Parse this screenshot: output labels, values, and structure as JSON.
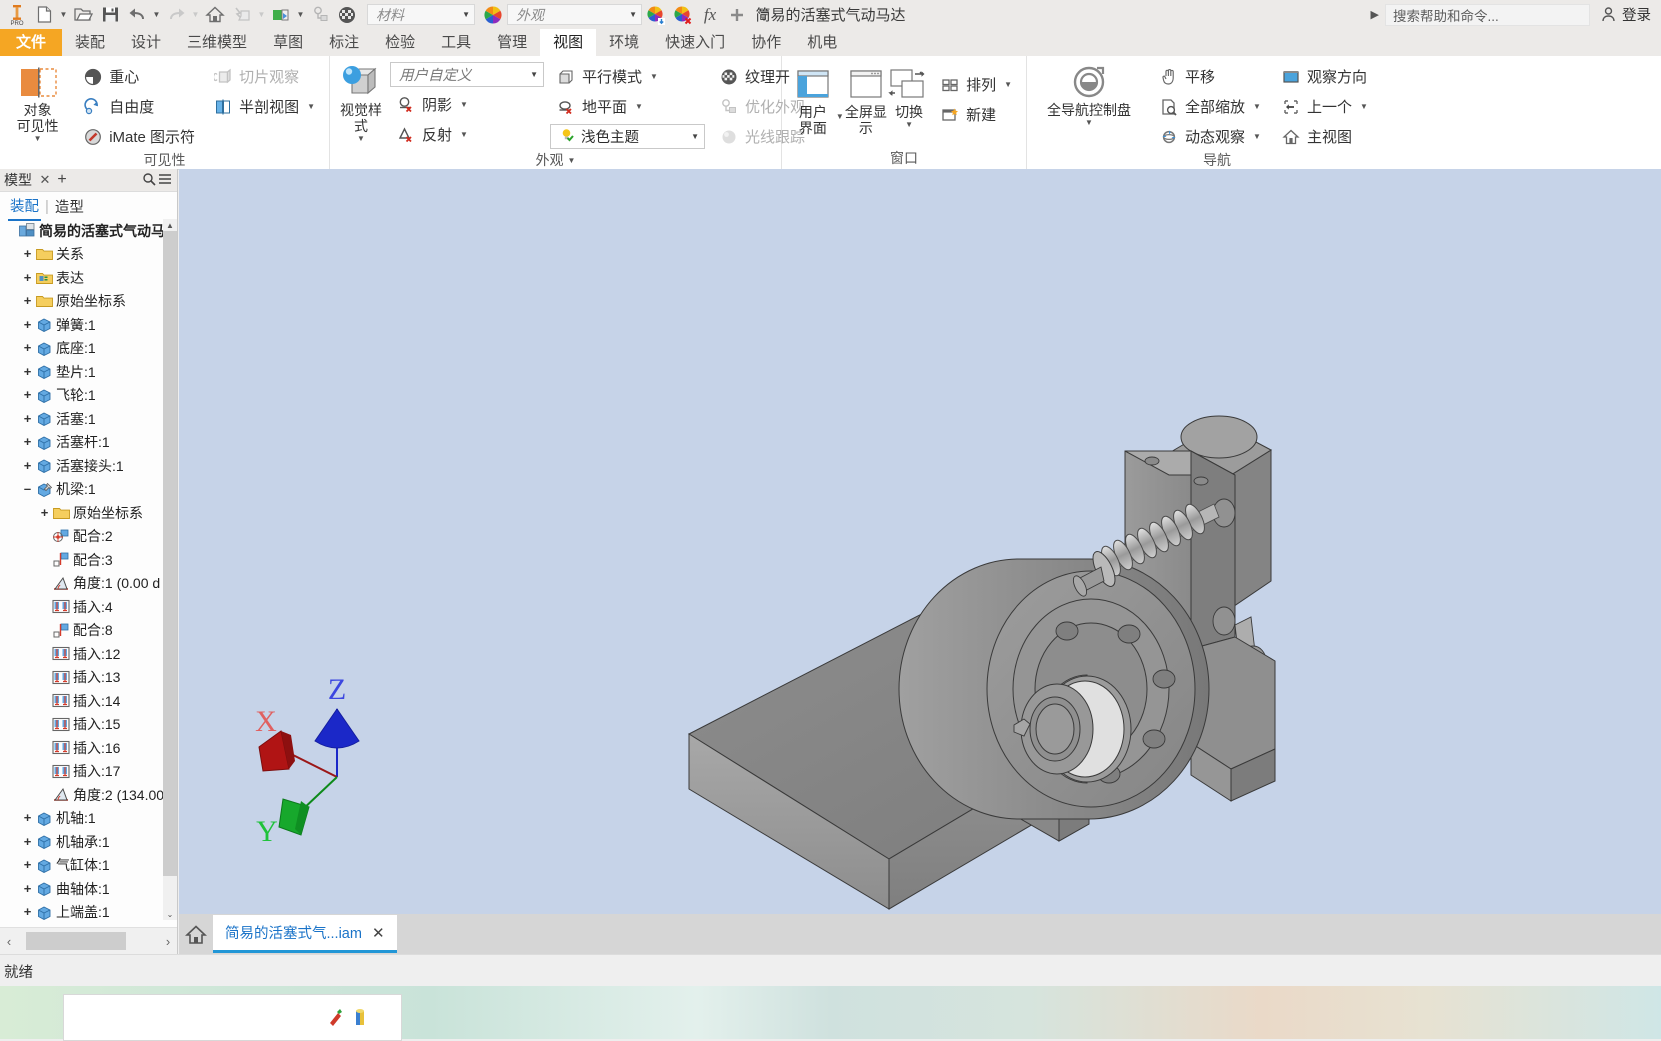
{
  "app": {
    "title": "简易的活塞式气动马达",
    "status": "就绪"
  },
  "quick_access": {
    "icons": [
      {
        "name": "inventor-logo-icon",
        "glyph": "PRO"
      },
      {
        "name": "new-file-icon",
        "glyph": "new"
      },
      {
        "name": "open-file-icon",
        "glyph": "open"
      },
      {
        "name": "save-icon",
        "glyph": "save"
      },
      {
        "name": "undo-icon",
        "glyph": "undo"
      },
      {
        "name": "redo-icon",
        "glyph": "redo"
      },
      {
        "name": "home-icon",
        "glyph": "home"
      },
      {
        "name": "update-icon",
        "glyph": "update"
      },
      {
        "name": "material-swatch-icon",
        "glyph": "swatch"
      },
      {
        "name": "select-icon",
        "glyph": "select"
      },
      {
        "name": "texture-icon",
        "glyph": "texture"
      }
    ],
    "material_placeholder": "材料",
    "appearance_placeholder": "外观",
    "fx_label": "fx"
  },
  "search": {
    "placeholder": "搜索帮助和命令...",
    "signin_label": "登录"
  },
  "tabs": [
    {
      "label": "文件",
      "kind": "file"
    },
    {
      "label": "装配",
      "kind": "normal"
    },
    {
      "label": "设计",
      "kind": "normal"
    },
    {
      "label": "三维模型",
      "kind": "normal"
    },
    {
      "label": "草图",
      "kind": "normal"
    },
    {
      "label": "标注",
      "kind": "normal"
    },
    {
      "label": "检验",
      "kind": "normal"
    },
    {
      "label": "工具",
      "kind": "normal"
    },
    {
      "label": "管理",
      "kind": "normal"
    },
    {
      "label": "视图",
      "kind": "active"
    },
    {
      "label": "环境",
      "kind": "normal"
    },
    {
      "label": "快速入门",
      "kind": "normal"
    },
    {
      "label": "协作",
      "kind": "normal"
    },
    {
      "label": "机电",
      "kind": "normal"
    }
  ],
  "ribbon": {
    "visibility_panel": {
      "label": "可见性",
      "big_button": {
        "label1": "对象",
        "label2": "可见性",
        "icon": "object-visibility-icon"
      },
      "col1": [
        {
          "label": "重心",
          "icon": "center-of-gravity-icon",
          "disabled": false,
          "dropdown": false
        },
        {
          "label": "自由度",
          "icon": "degrees-of-freedom-icon",
          "disabled": false,
          "dropdown": false
        },
        {
          "label": "iMate 图示符",
          "icon": "imate-glyph-icon",
          "disabled": false,
          "dropdown": false
        }
      ],
      "col2": [
        {
          "label": "切片观察",
          "icon": "slice-graphics-icon",
          "disabled": true,
          "dropdown": false
        },
        {
          "label": "半剖视图",
          "icon": "half-section-view-icon",
          "disabled": false,
          "dropdown": true
        }
      ]
    },
    "appearance_panel": {
      "label": "外观",
      "big_button": {
        "label1": "视觉样式",
        "label2": "",
        "icon": "visual-style-icon"
      },
      "style_combo": "用户自定义",
      "col1": [
        {
          "label": "阴影",
          "icon": "shadows-icon",
          "disabled": false,
          "dropdown": true
        },
        {
          "label": "反射",
          "icon": "reflection-icon",
          "disabled": false,
          "dropdown": true
        }
      ],
      "col2_top": {
        "label": "平行模式",
        "icon": "parallel-view-icon",
        "dropdown": true
      },
      "col2_mid": {
        "label": "地平面",
        "icon": "ground-plane-icon",
        "dropdown": true
      },
      "theme_combo": {
        "label": "浅色主题",
        "icon": "light-theme-icon"
      },
      "col3": [
        {
          "label": "纹理开",
          "icon": "texture-on-icon",
          "disabled": false,
          "dropdown": true
        },
        {
          "label": "优化外观",
          "icon": "optimize-appearance-icon",
          "disabled": true,
          "dropdown": false
        },
        {
          "label": "光线跟踪",
          "icon": "ray-tracing-icon",
          "disabled": true,
          "dropdown": false
        }
      ]
    },
    "window_panel": {
      "label": "窗口",
      "buttons": [
        {
          "label1": "用户",
          "label2": "界面",
          "icon": "user-interface-icon",
          "dropdown": true
        },
        {
          "label1": "全屏显示",
          "label2": "",
          "icon": "full-screen-icon",
          "dropdown": false
        },
        {
          "label1": "切换",
          "label2": "",
          "icon": "switch-window-icon",
          "dropdown": true
        }
      ],
      "col": [
        {
          "label": "排列",
          "icon": "arrange-icon",
          "dropdown": true
        },
        {
          "label": "新建",
          "icon": "new-window-icon",
          "dropdown": false
        }
      ]
    },
    "navigate_panel": {
      "label": "导航",
      "big_button": {
        "label1": "全导航控制盘",
        "label2": "",
        "icon": "steering-wheel-icon"
      },
      "col1": [
        {
          "label": "平移",
          "icon": "pan-icon",
          "dropdown": false
        },
        {
          "label": "全部缩放",
          "icon": "zoom-all-icon",
          "dropdown": true
        },
        {
          "label": "动态观察",
          "icon": "orbit-icon",
          "dropdown": true
        }
      ],
      "col2": [
        {
          "label": "观察方向",
          "icon": "view-direction-icon",
          "dropdown": false
        },
        {
          "label": "上一个",
          "icon": "previous-view-icon",
          "dropdown": true
        },
        {
          "label": "主视图",
          "icon": "home-view-icon",
          "dropdown": false
        }
      ]
    }
  },
  "browser": {
    "title": "模型",
    "close_label": "✕",
    "add_label": "+",
    "search_icon": "search-icon",
    "menu_icon": "hamburger-icon",
    "subtabs": [
      {
        "label": "装配",
        "selected": true
      },
      {
        "label": "造型",
        "selected": false
      }
    ],
    "tree": [
      {
        "depth": 0,
        "exp": "none",
        "icon": "assembly-icon",
        "label": "简易的活塞式气动马达",
        "root": true
      },
      {
        "depth": 1,
        "exp": "plus",
        "icon": "folder-icon",
        "label": "关系"
      },
      {
        "depth": 1,
        "exp": "plus",
        "icon": "representation-icon",
        "label": "表达"
      },
      {
        "depth": 1,
        "exp": "plus",
        "icon": "folder-icon",
        "label": "原始坐标系"
      },
      {
        "depth": 1,
        "exp": "plus",
        "icon": "part-icon",
        "label": "弹簧:1"
      },
      {
        "depth": 1,
        "exp": "plus",
        "icon": "part-icon",
        "label": "底座:1"
      },
      {
        "depth": 1,
        "exp": "plus",
        "icon": "part-icon",
        "label": "垫片:1"
      },
      {
        "depth": 1,
        "exp": "plus",
        "icon": "part-icon",
        "label": "飞轮:1"
      },
      {
        "depth": 1,
        "exp": "plus",
        "icon": "part-icon",
        "label": "活塞:1"
      },
      {
        "depth": 1,
        "exp": "plus",
        "icon": "part-icon",
        "label": "活塞杆:1"
      },
      {
        "depth": 1,
        "exp": "plus",
        "icon": "part-icon",
        "label": "活塞接头:1"
      },
      {
        "depth": 1,
        "exp": "minus",
        "icon": "part-pinned-icon",
        "label": "机梁:1"
      },
      {
        "depth": 2,
        "exp": "plus",
        "icon": "folder-icon",
        "label": "原始坐标系"
      },
      {
        "depth": 2,
        "exp": "none",
        "icon": "mate-insert-icon",
        "label": "配合:2"
      },
      {
        "depth": 2,
        "exp": "none",
        "icon": "mate-flush-icon",
        "label": "配合:3"
      },
      {
        "depth": 2,
        "exp": "none",
        "icon": "angle-icon",
        "label": "角度:1 (0.00 d"
      },
      {
        "depth": 2,
        "exp": "none",
        "icon": "insert-icon",
        "label": "插入:4"
      },
      {
        "depth": 2,
        "exp": "none",
        "icon": "mate-flush-icon",
        "label": "配合:8"
      },
      {
        "depth": 2,
        "exp": "none",
        "icon": "insert-icon",
        "label": "插入:12"
      },
      {
        "depth": 2,
        "exp": "none",
        "icon": "insert-icon",
        "label": "插入:13"
      },
      {
        "depth": 2,
        "exp": "none",
        "icon": "insert-icon",
        "label": "插入:14"
      },
      {
        "depth": 2,
        "exp": "none",
        "icon": "insert-icon",
        "label": "插入:15"
      },
      {
        "depth": 2,
        "exp": "none",
        "icon": "insert-icon",
        "label": "插入:16"
      },
      {
        "depth": 2,
        "exp": "none",
        "icon": "insert-icon",
        "label": "插入:17"
      },
      {
        "depth": 2,
        "exp": "none",
        "icon": "angle-icon",
        "label": "角度:2 (134.00"
      },
      {
        "depth": 1,
        "exp": "plus",
        "icon": "part-icon",
        "label": "机轴:1"
      },
      {
        "depth": 1,
        "exp": "plus",
        "icon": "part-icon",
        "label": "机轴承:1"
      },
      {
        "depth": 1,
        "exp": "plus",
        "icon": "part-icon",
        "label": "气缸体:1"
      },
      {
        "depth": 1,
        "exp": "plus",
        "icon": "part-icon",
        "label": "曲轴体:1"
      },
      {
        "depth": 1,
        "exp": "plus",
        "icon": "part-icon",
        "label": "上端盖:1"
      }
    ]
  },
  "viewport": {
    "background_color": "#c6d3e8",
    "axis_labels": {
      "x": "X",
      "y": "Y",
      "z": "Z"
    },
    "axis_colors": {
      "x": "#d93030",
      "y": "#17a82c",
      "z": "#1b28c8"
    }
  },
  "doc_tabs": {
    "home_icon": "home-icon",
    "tabs": [
      {
        "label": "简易的活塞式气...iam",
        "close": "✕",
        "active": true
      }
    ]
  }
}
